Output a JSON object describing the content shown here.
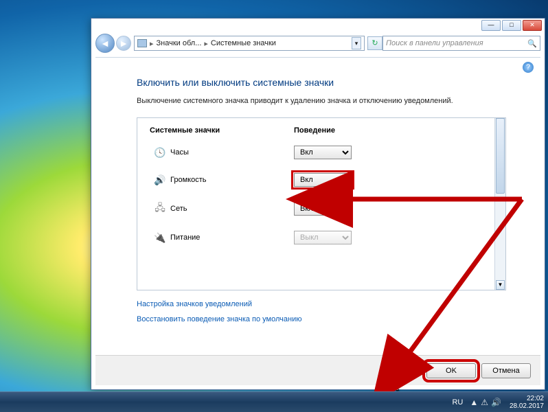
{
  "taskbar": {
    "lang": "RU",
    "time": "22:02",
    "date": "28.02.2017",
    "tray": {
      "flag": "▲",
      "net": "⚠",
      "vol": "🔊"
    }
  },
  "window": {
    "title_btns": {
      "min": "—",
      "max": "□",
      "close": "✕"
    },
    "crumb": {
      "part1": "Значки обл...",
      "part2": "Системные значки",
      "sep": "▸",
      "ddl": "▾",
      "refresh": "↻"
    },
    "search_placeholder": "Поиск в панели управления",
    "search_icon": "🔍",
    "help_icon": "?"
  },
  "page": {
    "title": "Включить или выключить системные значки",
    "desc": "Выключение системного значка приводит к удалению значка и отключению уведомлений."
  },
  "table": {
    "col1": "Системные значки",
    "col2": "Поведение",
    "rows": [
      {
        "icon": "🕓",
        "label": "Часы",
        "value": "Вкл",
        "disabled": false,
        "hl": false
      },
      {
        "icon": "🔊",
        "label": "Громкость",
        "value": "Вкл",
        "disabled": false,
        "hl": true
      },
      {
        "icon": "🖧",
        "label": "Сеть",
        "value": "Вкл",
        "disabled": false,
        "hl": false
      },
      {
        "icon": "🔌",
        "label": "Питание",
        "value": "Выкл",
        "disabled": true,
        "hl": false
      }
    ]
  },
  "links": {
    "l1": "Настройка значков уведомлений",
    "l2": "Восстановить поведение значка по умолчанию"
  },
  "footer": {
    "ok": "OK",
    "cancel": "Отмена"
  },
  "annotation": {
    "color": "#c00000"
  }
}
